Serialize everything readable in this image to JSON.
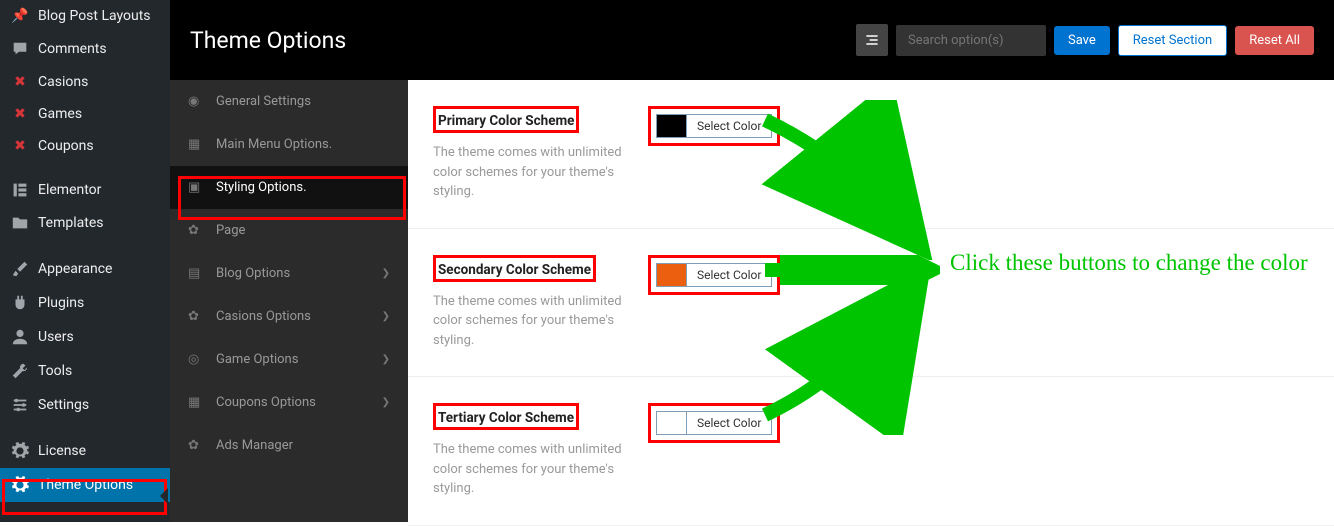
{
  "wp_menu": {
    "blog_layouts": "Blog Post Layouts",
    "comments": "Comments",
    "casions": "Casions",
    "games": "Games",
    "coupons": "Coupons",
    "elementor": "Elementor",
    "templates": "Templates",
    "appearance": "Appearance",
    "plugins": "Plugins",
    "users": "Users",
    "tools": "Tools",
    "settings": "Settings",
    "license": "License",
    "theme_options": "Theme Options"
  },
  "header": {
    "title": "Theme Options",
    "search_placeholder": "Search option(s)",
    "save": "Save",
    "reset_section": "Reset Section",
    "reset_all": "Reset All"
  },
  "sub_menu": {
    "general": "General Settings",
    "main_menu": "Main Menu Options.",
    "styling": "Styling Options.",
    "page": "Page",
    "blog": "Blog Options",
    "casions": "Casions Options",
    "game": "Game Options",
    "coupons": "Coupons Options",
    "ads": "Ads Manager"
  },
  "options": {
    "primary": {
      "title": "Primary Color Scheme",
      "desc": "The theme comes with unlimited color schemes for your theme's styling.",
      "btn": "Select Color",
      "color": "#000000"
    },
    "secondary": {
      "title": "Secondary Color Scheme",
      "desc": "The theme comes with unlimited color schemes for your theme's styling.",
      "btn": "Select Color",
      "color": "#ec5f0e"
    },
    "tertiary": {
      "title": "Tertiary Color Scheme",
      "desc": "The theme comes with unlimited color schemes for your theme's styling.",
      "btn": "Select Color",
      "color": "#ffffff"
    }
  },
  "annotation": "Click these buttons to change the color"
}
